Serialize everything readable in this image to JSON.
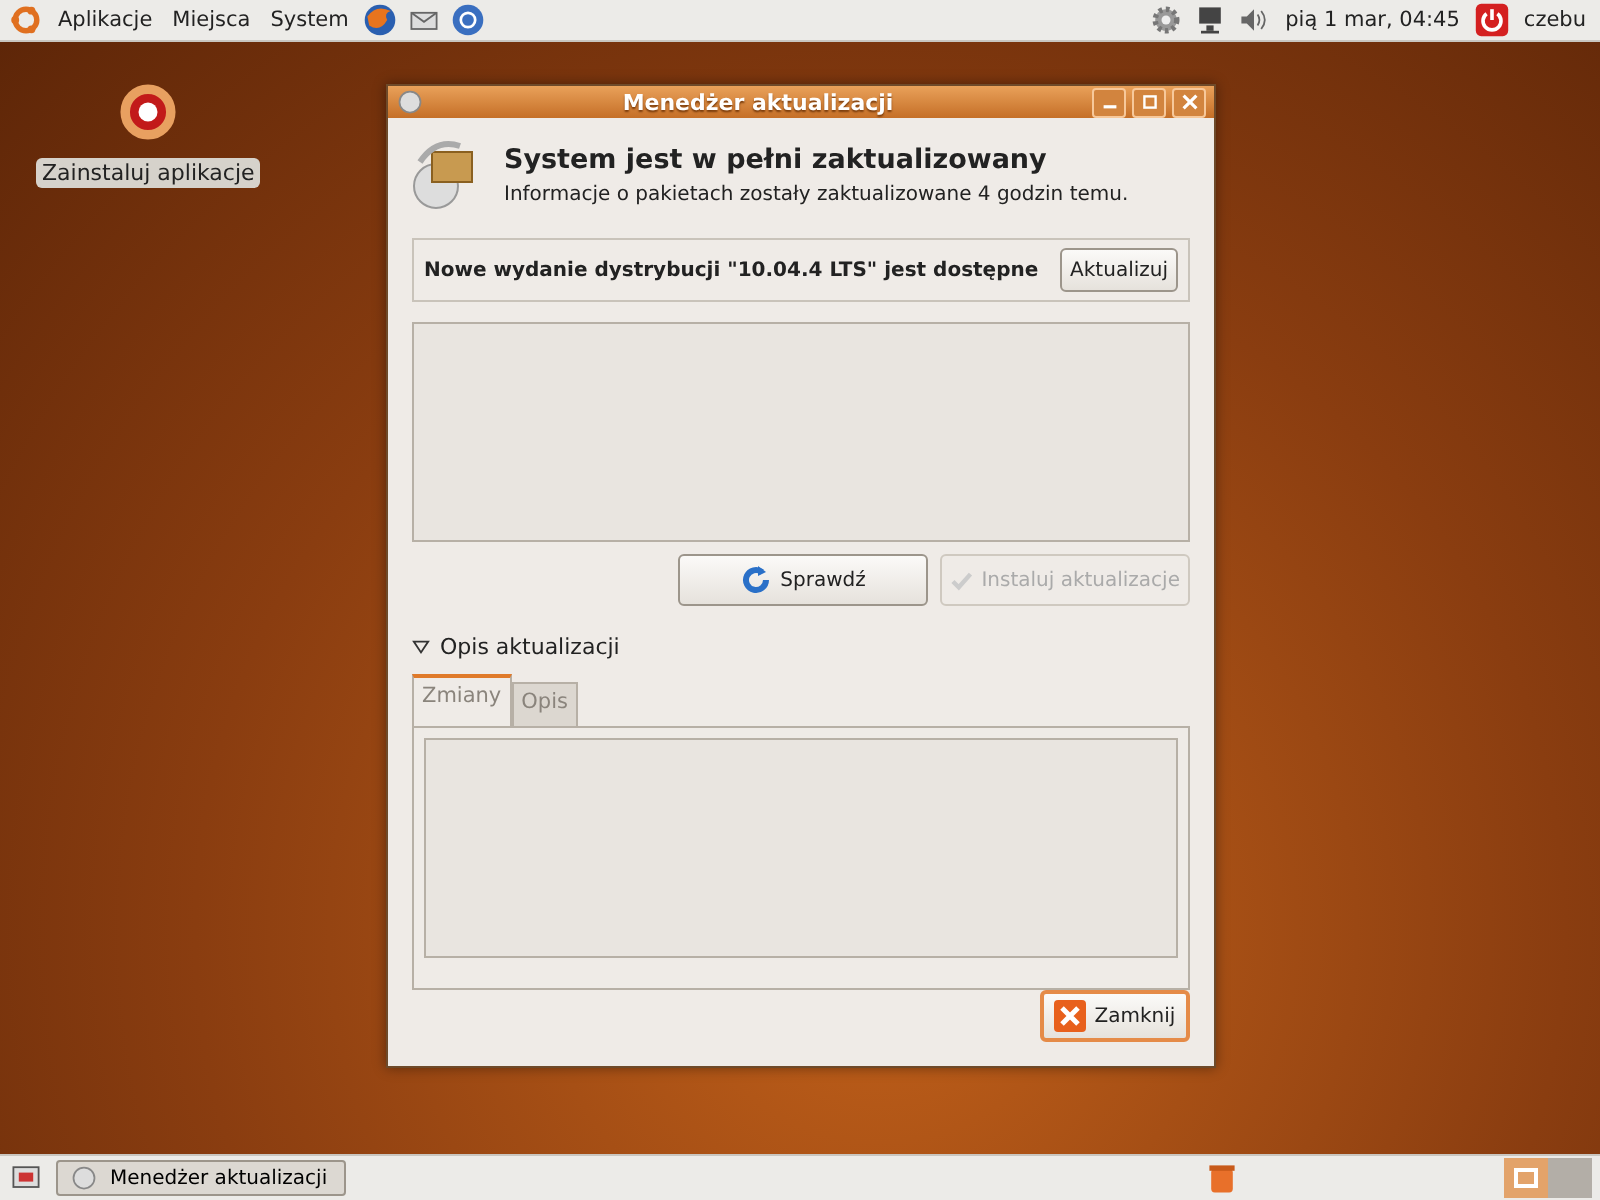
{
  "top_panel": {
    "menus": [
      "Aplikacje",
      "Miejsca",
      "System"
    ],
    "clock": "pią  1 mar, 04:45",
    "user": "czebu"
  },
  "desktop": {
    "icons": [
      {
        "label": "Zainstaluj aplikacje"
      }
    ]
  },
  "window": {
    "title": "Menedżer aktualizacji",
    "heading": "System jest w pełni zaktualizowany",
    "subheading": "Informacje o pakietach zostały zaktualizowane 4 godzin temu.",
    "release_notice": {
      "text": "Nowe wydanie dystrybucji \"10.04.4 LTS\" jest dostępne",
      "button": "Aktualizuj"
    },
    "buttons": [
      {
        "label": "Sprawdź",
        "kind": "check",
        "disabled": false
      },
      {
        "label": "Instaluj aktualizacje",
        "kind": "install",
        "disabled": true
      }
    ],
    "expander": {
      "label": "Opis aktualizacji",
      "expanded": true
    },
    "tabs": [
      {
        "label": "Zmiany",
        "selected": true,
        "disabled": true
      },
      {
        "label": "Opis",
        "selected": false,
        "disabled": true
      }
    ],
    "close_button": "Zamknij"
  },
  "bottom_panel": {
    "tasks": [
      {
        "label": "Menedżer aktualizacji"
      }
    ],
    "workspaces": [
      {
        "selected": true
      },
      {
        "selected": false
      }
    ]
  }
}
